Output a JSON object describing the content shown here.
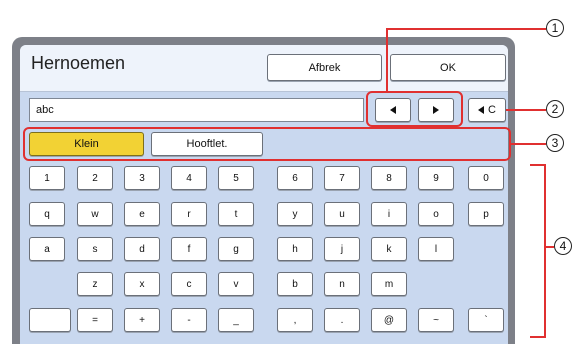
{
  "dialog": {
    "title": "Hernoemen",
    "cancel_label": "Afbrek",
    "ok_label": "OK",
    "input_value": "abc",
    "clear_label": "C"
  },
  "modes": {
    "lower_label": "Klein",
    "upper_label": "Hooftlet."
  },
  "keyboard": {
    "row1": [
      "1",
      "2",
      "3",
      "4",
      "5",
      "6",
      "7",
      "8",
      "9",
      "0"
    ],
    "row2": [
      "q",
      "w",
      "e",
      "r",
      "t",
      "y",
      "u",
      "i",
      "o",
      "p"
    ],
    "row3": [
      "a",
      "s",
      "d",
      "f",
      "g",
      "h",
      "j",
      "k",
      "l"
    ],
    "row4": [
      "z",
      "x",
      "c",
      "v",
      "b",
      "n",
      "m"
    ],
    "row5": [
      "",
      "=",
      "+",
      "-",
      "_",
      ",",
      ".",
      "@",
      "~",
      "`"
    ]
  },
  "callouts": [
    "1",
    "2",
    "3",
    "4"
  ],
  "colors": {
    "accent_red": "#e03030",
    "selected_yellow": "#f2d234",
    "panel_blue": "#c9d8ef"
  }
}
